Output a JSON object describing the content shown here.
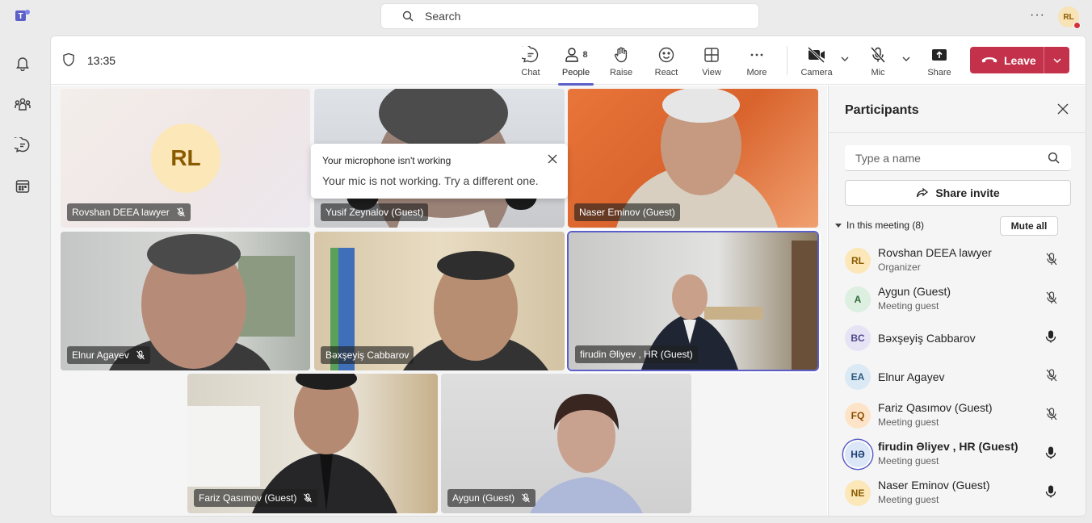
{
  "app": {
    "title": "Microsoft Teams"
  },
  "topbar": {
    "search_placeholder": "Search",
    "more": "···",
    "user_initials": "RL"
  },
  "meeting": {
    "time": "13:35",
    "toolbar": {
      "chat": "Chat",
      "people": "People",
      "people_count": "8",
      "raise": "Raise",
      "react": "React",
      "view": "View",
      "more": "More",
      "camera": "Camera",
      "mic": "Mic",
      "share": "Share",
      "leave": "Leave"
    },
    "tiles": [
      {
        "name": "Rovshan DEEA lawyer",
        "initials": "RL",
        "muted": true
      },
      {
        "name": "Yusif Zeynalov (Guest)",
        "muted": false
      },
      {
        "name": "Naser Eminov (Guest)",
        "muted": false
      },
      {
        "name": "Elnur Agayev",
        "muted": true
      },
      {
        "name": "Bəxşeyiş Cabbarov",
        "muted": false
      },
      {
        "name": "firudin Əliyev , HR (Guest)",
        "muted": false
      },
      {
        "name": "Fariz Qasımov (Guest)",
        "muted": true
      },
      {
        "name": "Aygun (Guest)",
        "muted": true
      }
    ],
    "toast": {
      "title": "Your microphone isn't working",
      "body": "Your mic is not working. Try a different one."
    }
  },
  "participants": {
    "title": "Participants",
    "search_placeholder": "Type a name",
    "share_invite": "Share invite",
    "section": "In this meeting (8)",
    "mute_all": "Mute all",
    "list": [
      {
        "initials": "RL",
        "name": "Rovshan DEEA lawyer",
        "role": "Organizer",
        "muted": true,
        "bg": "#fbe7b8",
        "fg": "#8a5a00"
      },
      {
        "initials": "A",
        "name": "Aygun (Guest)",
        "role": "Meeting guest",
        "muted": true,
        "bg": "#dcefe0",
        "fg": "#2f6b3c"
      },
      {
        "initials": "BC",
        "name": "Bəxşeyiş Cabbarov",
        "role": "",
        "muted": false,
        "bg": "#e6e3f5",
        "fg": "#4f4a8c"
      },
      {
        "initials": "EA",
        "name": "Elnur Agayev",
        "role": "",
        "muted": true,
        "bg": "#dbe9f4",
        "fg": "#2c5a7d"
      },
      {
        "initials": "FQ",
        "name": "Fariz Qasımov (Guest)",
        "role": "Meeting guest",
        "muted": true,
        "bg": "#fde4c8",
        "fg": "#8a4b00"
      },
      {
        "initials": "HƏ",
        "name": "firudin Əliyev , HR (Guest)",
        "role": "Meeting guest",
        "muted": false,
        "bg": "#dbe6f6",
        "fg": "#1f3f73"
      },
      {
        "initials": "NE",
        "name": "Naser Eminov (Guest)",
        "role": "Meeting guest",
        "muted": false,
        "bg": "#fbe7b8",
        "fg": "#8a5a00"
      }
    ]
  },
  "colors": {
    "accent": "#5b5fc7",
    "leave": "#c4314b"
  }
}
